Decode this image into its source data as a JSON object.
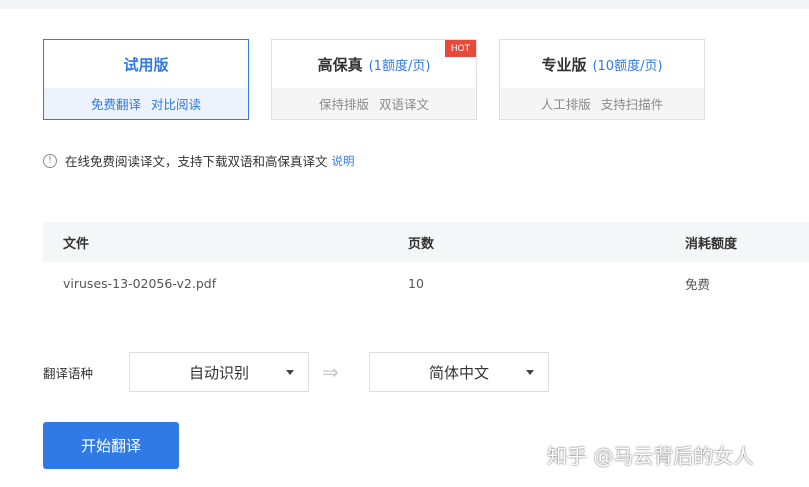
{
  "plans": [
    {
      "name": "试用版",
      "price": "",
      "features": [
        "免费翻译",
        "对比阅读"
      ],
      "badge": ""
    },
    {
      "name": "高保真",
      "price": "(1额度/页)",
      "features": [
        "保持排版",
        "双语译文"
      ],
      "badge": "HOT"
    },
    {
      "name": "专业版",
      "price": "(10额度/页)",
      "features": [
        "人工排版",
        "支持扫描件"
      ],
      "badge": ""
    }
  ],
  "notice": {
    "text": "在线免费阅读译文，支持下载双语和高保真译文",
    "link": "说明"
  },
  "table": {
    "headers": [
      "文件",
      "页数",
      "消耗额度"
    ],
    "rows": [
      [
        "viruses-13-02056-v2.pdf",
        "10",
        "免费"
      ]
    ]
  },
  "language": {
    "label": "翻译语种",
    "source": "自动识别",
    "target": "简体中文"
  },
  "actions": {
    "start": "开始翻译"
  },
  "watermark": "知乎 @马云背后的女人",
  "colors": {
    "accent": "#2f7ae5",
    "hot_badge": "#e64a3b"
  }
}
